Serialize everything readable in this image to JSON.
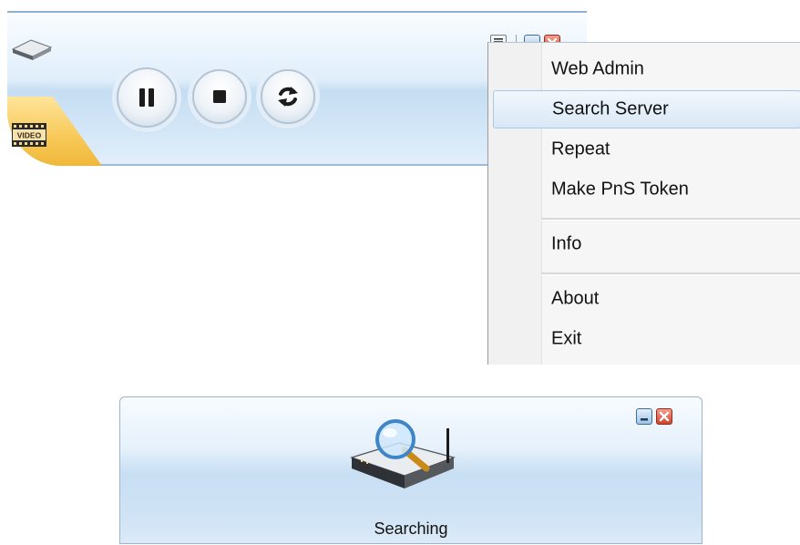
{
  "player": {
    "icons": {
      "device": "device-icon",
      "video": "video-film-icon",
      "pause": "pause-icon",
      "stop": "stop-icon",
      "repeat": "repeat-icon",
      "menu": "menu-icon",
      "minimize": "minimize-icon",
      "close": "close-icon"
    },
    "video_badge": "VIDEO"
  },
  "context_menu": {
    "items": [
      {
        "label": "Web Admin"
      },
      {
        "label": "Search Server",
        "highlighted": true
      },
      {
        "label": "Repeat"
      },
      {
        "label": "Make PnS Token"
      },
      {
        "label": "Info"
      },
      {
        "label": "About"
      },
      {
        "label": "Exit"
      }
    ]
  },
  "search_window": {
    "status": "Searching",
    "icons": {
      "main": "router-search-icon",
      "minimize": "minimize-icon",
      "close": "close-icon"
    }
  },
  "colors": {
    "accent_blue": "#c5ddf2",
    "tab_gold": "#f7c957",
    "close_red": "#d2442a",
    "hover_blue": "#d9e8f6"
  }
}
